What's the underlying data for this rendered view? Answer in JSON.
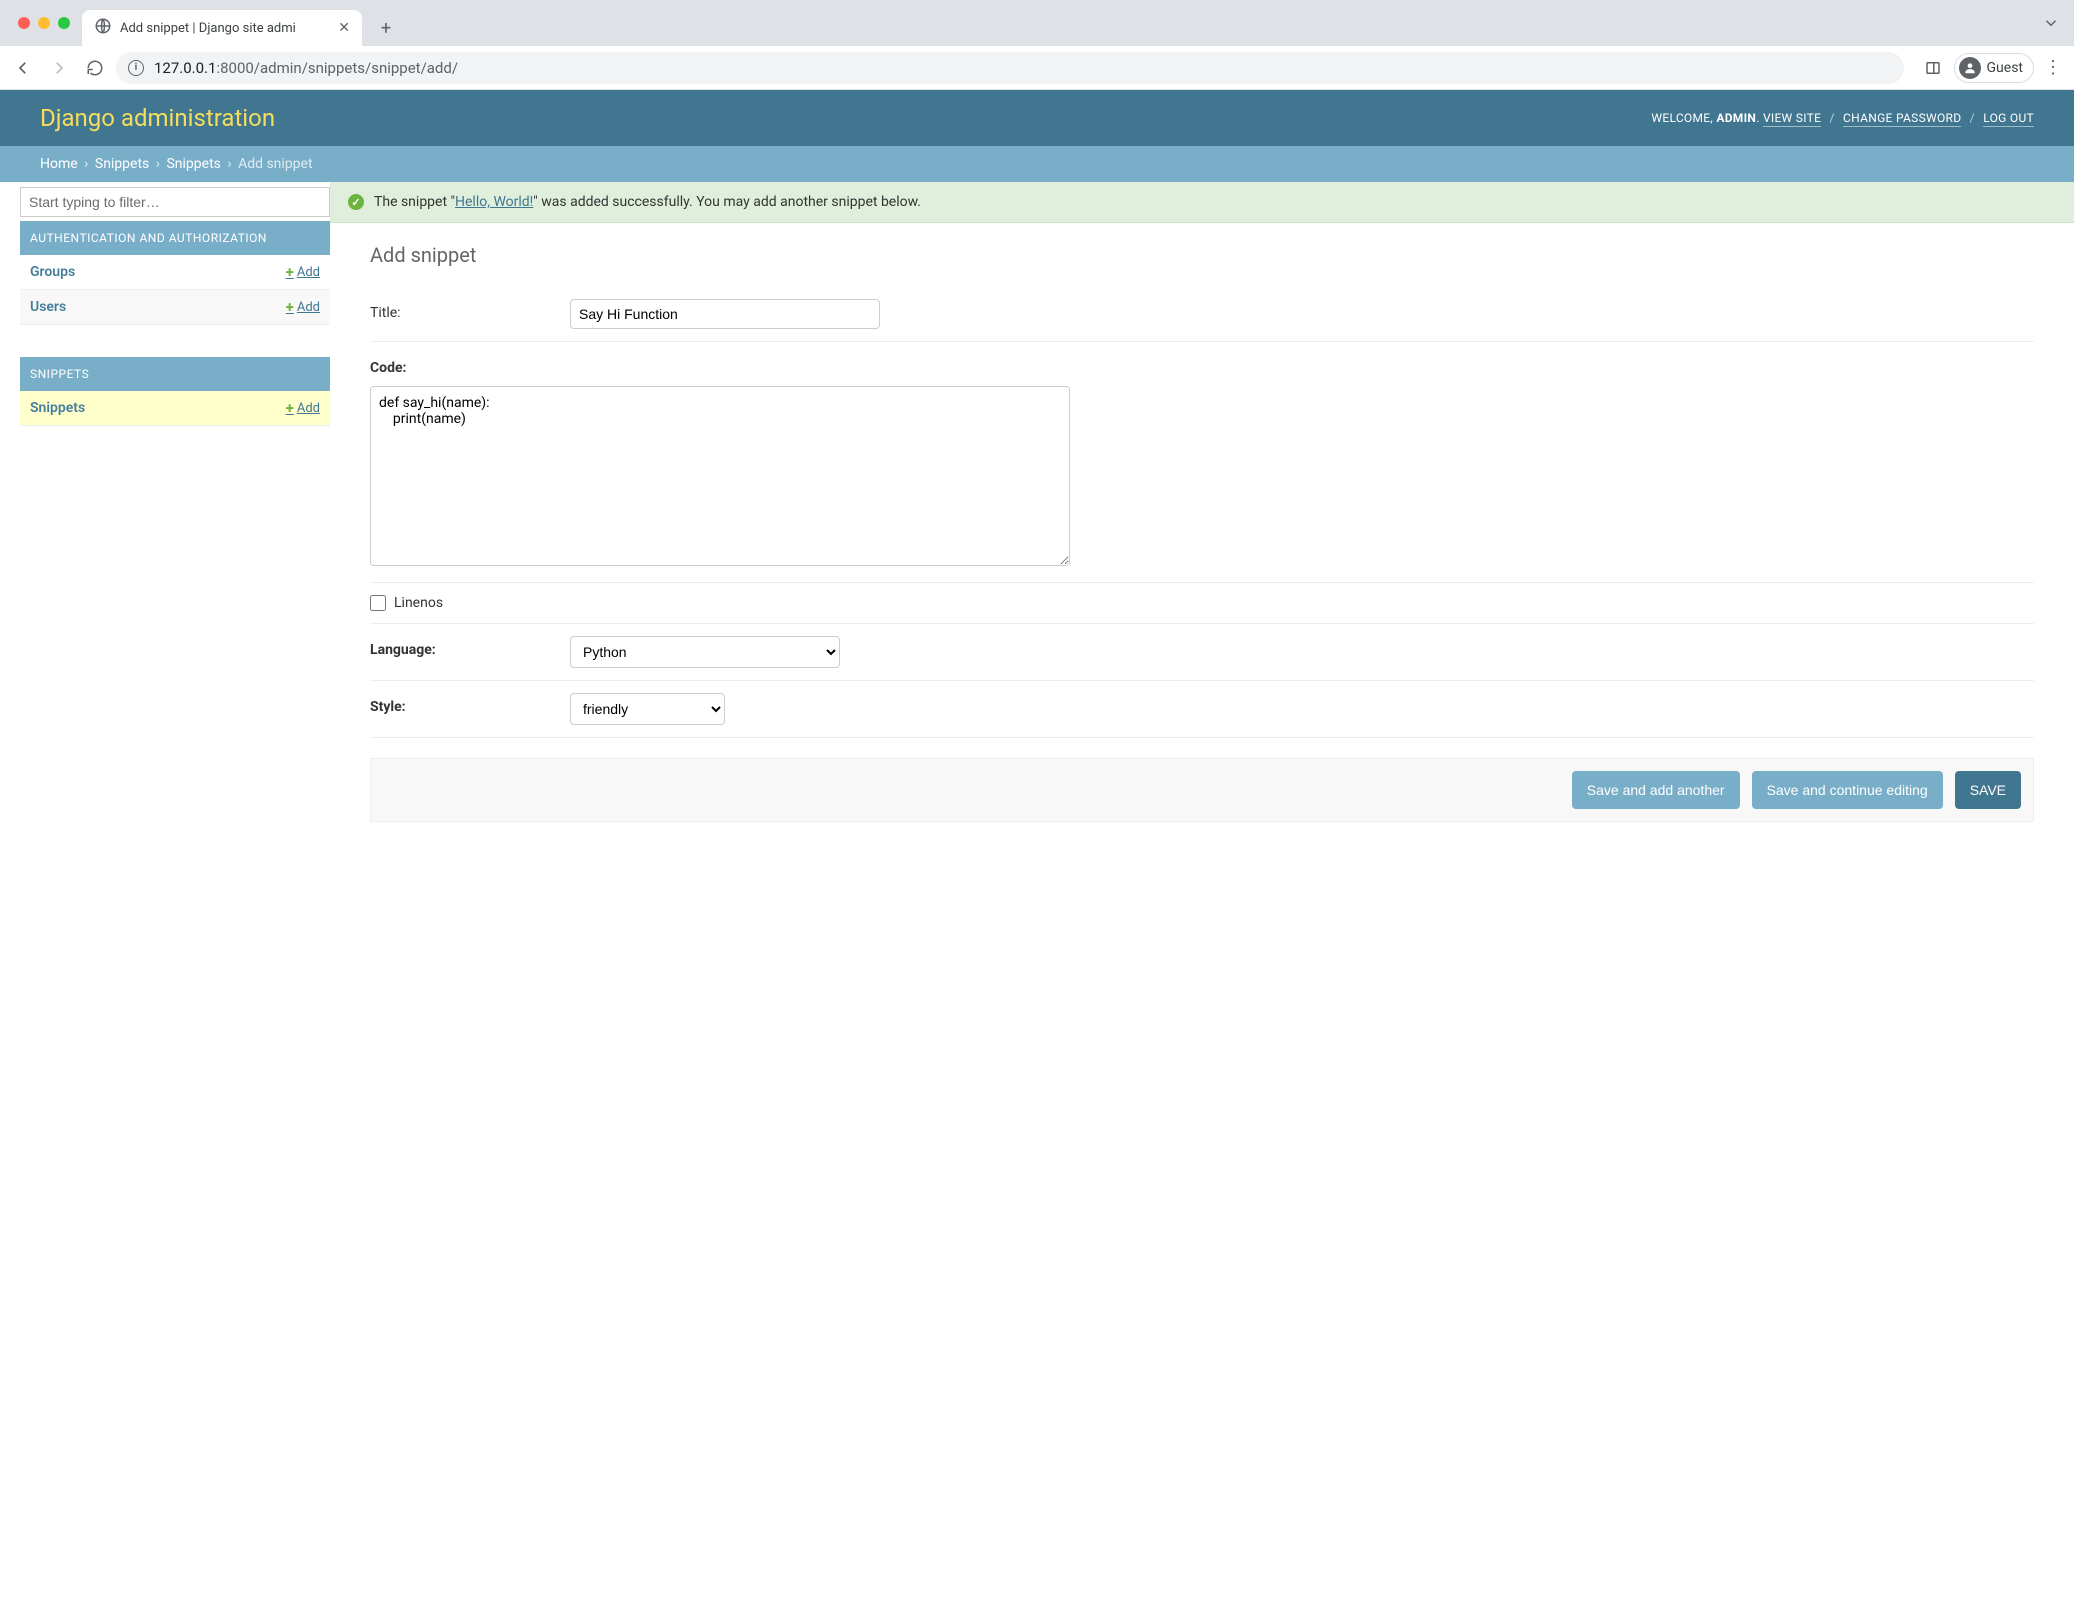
{
  "browser": {
    "tab_title": "Add snippet | Django site admi",
    "url_host": "127.0.0.1",
    "url_port_path": ":8000/admin/snippets/snippet/add/",
    "guest_label": "Guest"
  },
  "header": {
    "branding": "Django administration",
    "welcome": "WELCOME,",
    "username": "ADMIN",
    "view_site": "VIEW SITE",
    "change_password": "CHANGE PASSWORD",
    "logout": "LOG OUT"
  },
  "breadcrumbs": {
    "home": "Home",
    "snippets_app": "Snippets",
    "snippets_model": "Snippets",
    "final": "Add snippet"
  },
  "sidebar": {
    "filter_placeholder": "Start typing to filter…",
    "apps": [
      {
        "caption": "AUTHENTICATION AND AUTHORIZATION",
        "models": [
          {
            "name": "Groups",
            "add": "Add"
          },
          {
            "name": "Users",
            "add": "Add"
          }
        ]
      },
      {
        "caption": "SNIPPETS",
        "models": [
          {
            "name": "Snippets",
            "add": "Add",
            "active": true
          }
        ]
      }
    ]
  },
  "message": {
    "prefix": "The snippet \"",
    "link": "Hello, World!",
    "suffix": "\" was added successfully. You may add another snippet below."
  },
  "form": {
    "title": "Add snippet",
    "fields": {
      "title_label": "Title:",
      "title_value": "Say Hi Function",
      "code_label": "Code:",
      "code_value": "def say_hi(name):\n    print(name)",
      "linenos_label": "Linenos",
      "language_label": "Language:",
      "language_value": "Python",
      "style_label": "Style:",
      "style_value": "friendly"
    },
    "buttons": {
      "save_add_another": "Save and add another",
      "save_continue": "Save and continue editing",
      "save": "SAVE"
    }
  }
}
